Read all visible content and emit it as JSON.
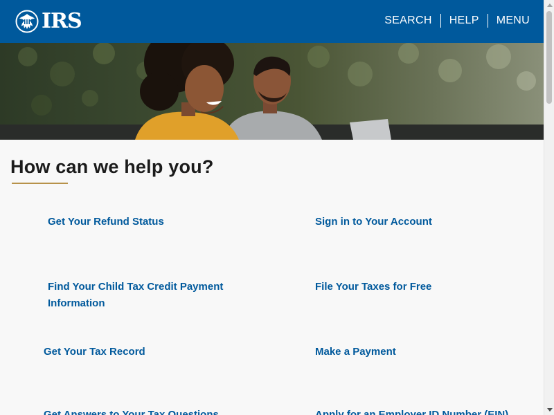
{
  "header": {
    "logo_text": "IRS",
    "logo_icon": "eagle-seal-icon",
    "nav": [
      {
        "label": "SEARCH"
      },
      {
        "label": "HELP"
      },
      {
        "label": "MENU"
      }
    ],
    "background": "#00599c"
  },
  "main": {
    "heading": "How can we help you?",
    "links": [
      {
        "label": "Get Your Refund Status"
      },
      {
        "label": "Sign in to Your Account"
      },
      {
        "label": "Find Your Child Tax Credit Payment Information"
      },
      {
        "label": "File Your Taxes for Free"
      },
      {
        "label": "Get Your Tax Record"
      },
      {
        "label": "Make a Payment"
      },
      {
        "label": "Get Answers to Your Tax Questions"
      },
      {
        "label": "Apply for an Employer ID Number (EIN)"
      }
    ],
    "link_color": "#00599c",
    "accent": "#b7924a"
  },
  "scrollbar": {
    "up_icon": "triangle-up-icon",
    "down_icon": "triangle-down-icon"
  }
}
